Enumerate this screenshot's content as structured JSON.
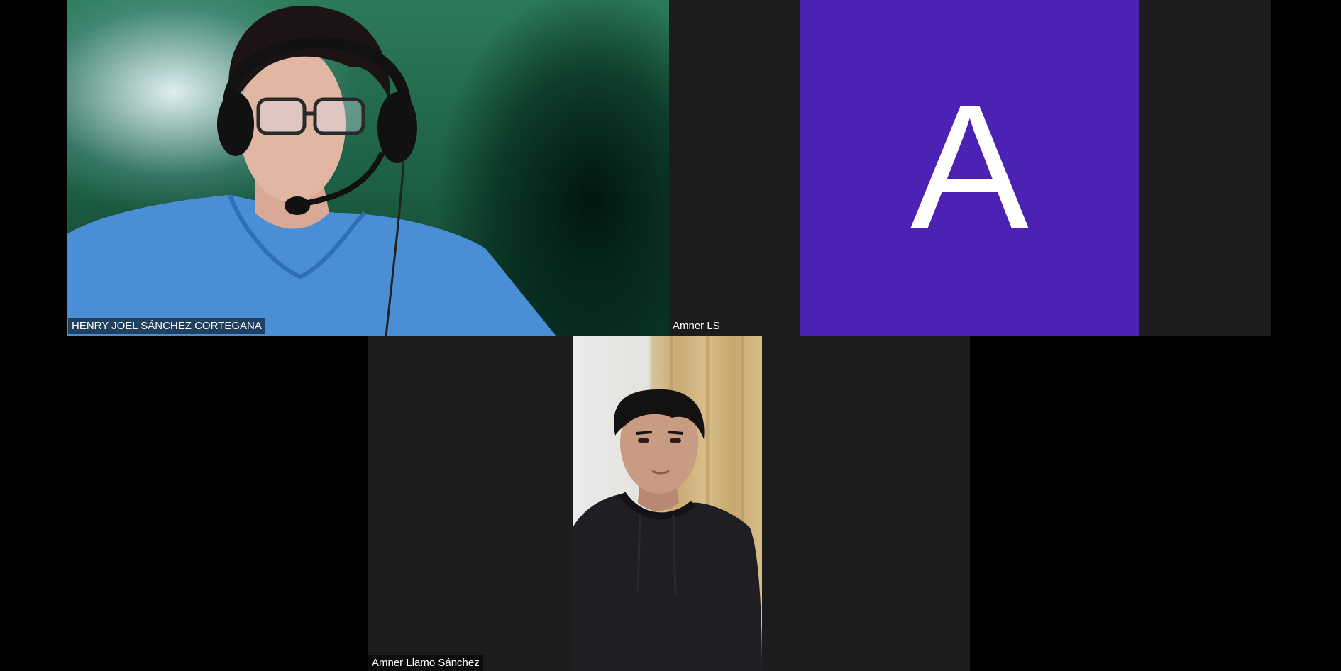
{
  "meeting": {
    "participants": [
      {
        "name": "HENRY JOEL SÁNCHEZ CORTEGANA",
        "video": "on",
        "avatar_letter": ""
      },
      {
        "name": "Amner LS",
        "video": "off",
        "avatar_letter": "A",
        "avatar_color": "#4b22b4"
      },
      {
        "name": "Amner Llamo Sánchez",
        "video": "on",
        "avatar_letter": ""
      }
    ]
  },
  "colors": {
    "background": "#000000",
    "tile_background": "#1c1c1c",
    "avatar": "#4b22b4"
  }
}
